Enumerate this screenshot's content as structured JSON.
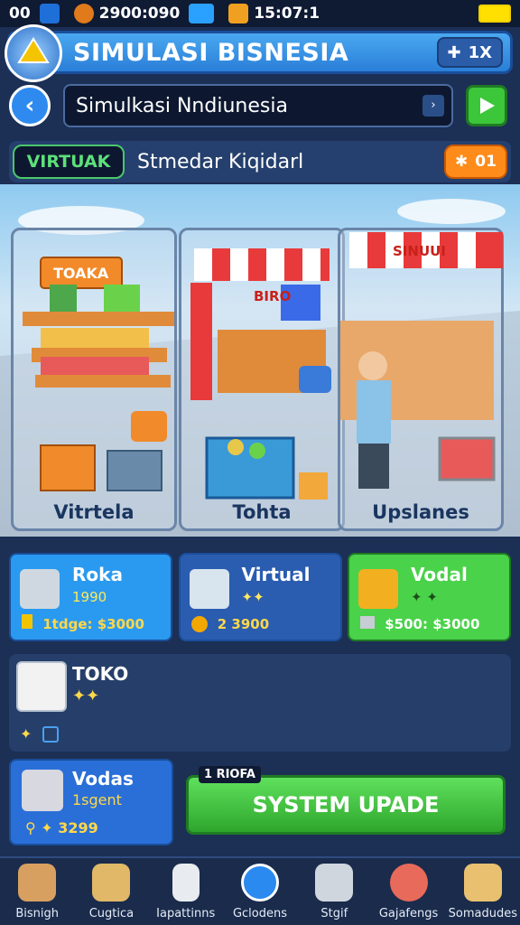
{
  "status": {
    "left": "00",
    "balance": "2900:090",
    "time": "15:07:1"
  },
  "header": {
    "title": "SIMULASI BISNESIA",
    "puzzle_count": "1X"
  },
  "nav": {
    "search_value": "Simulkasi Nndiunesia"
  },
  "info": {
    "virtual_label": "VIRTUAK",
    "text": "Stmedar Kiqidarl",
    "gold": "01"
  },
  "scene": {
    "labels": [
      "Vitrtela",
      "Tohta",
      "Upslanes"
    ],
    "signs": [
      "TOAKA",
      "BIRO",
      "SINUUI"
    ]
  },
  "cards": [
    {
      "title": "Roka",
      "line2": "1990",
      "foot": "1tdge: $3000"
    },
    {
      "title": "Virtual",
      "line2": "✦✦",
      "foot": "2 3900"
    },
    {
      "title": "Vodal",
      "line2": "✦     ✦",
      "foot": "$500: $3000"
    }
  ],
  "toko": {
    "title": "TOKO",
    "sparkle": "✦✦"
  },
  "vodas": {
    "title": "Vodas",
    "line2": "1sgent",
    "foot": "3299"
  },
  "upgrade": {
    "tag": "1 RIOFA",
    "label": "SYSTEM UPADE"
  },
  "bottom_nav": [
    {
      "label": "Bisnigh",
      "icon": "shop-icon"
    },
    {
      "label": "Cugtica",
      "icon": "tools-icon"
    },
    {
      "label": "Iapattinns",
      "icon": "document-icon"
    },
    {
      "label": "Gclodens",
      "icon": "close-circle-icon"
    },
    {
      "label": "Stgif",
      "icon": "clipboard-icon"
    },
    {
      "label": "Gajafengs",
      "icon": "settings-icon"
    },
    {
      "label": "Somadudes",
      "icon": "mail-icon"
    }
  ],
  "colors": {
    "accent_blue": "#2a7fd8",
    "accent_green": "#3cc63a",
    "accent_orange": "#ff8c1a",
    "bg": "#1c2f55"
  }
}
